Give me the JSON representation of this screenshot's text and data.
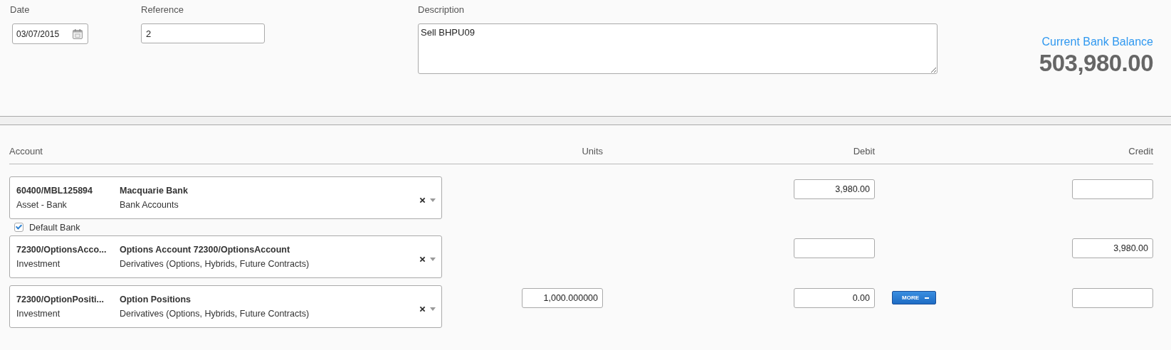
{
  "header": {
    "date": {
      "label": "Date",
      "value": "03/07/2015"
    },
    "reference": {
      "label": "Reference",
      "value": "2"
    },
    "description": {
      "label": "Description",
      "value": "Sell BHPU09"
    },
    "balance": {
      "label": "Current Bank Balance",
      "value": "503,980.00"
    }
  },
  "columns": [
    "Account",
    "Units",
    "Debit",
    "Credit"
  ],
  "rows": [
    {
      "account": {
        "code": "60400/MBL125894",
        "name": "Macquarie Bank",
        "type": "Asset - Bank",
        "category": "Bank Accounts"
      },
      "debit": "3,980.00",
      "credit": "",
      "default_bank": {
        "label": "Default Bank",
        "checked": true
      }
    },
    {
      "account": {
        "code": "72300/OptionsAcco...",
        "name": "Options Account 72300/OptionsAccount",
        "type": "Investment",
        "category": "Derivatives (Options, Hybrids, Future Contracts)"
      },
      "debit": "",
      "credit": "3,980.00"
    },
    {
      "account": {
        "code": "72300/OptionPositi...",
        "name": "Option Positions",
        "type": "Investment",
        "category": "Derivatives (Options, Hybrids, Future Contracts)"
      },
      "units": "1,000.000000",
      "debit": "0.00",
      "credit": "",
      "more_button": "MORE"
    }
  ]
}
